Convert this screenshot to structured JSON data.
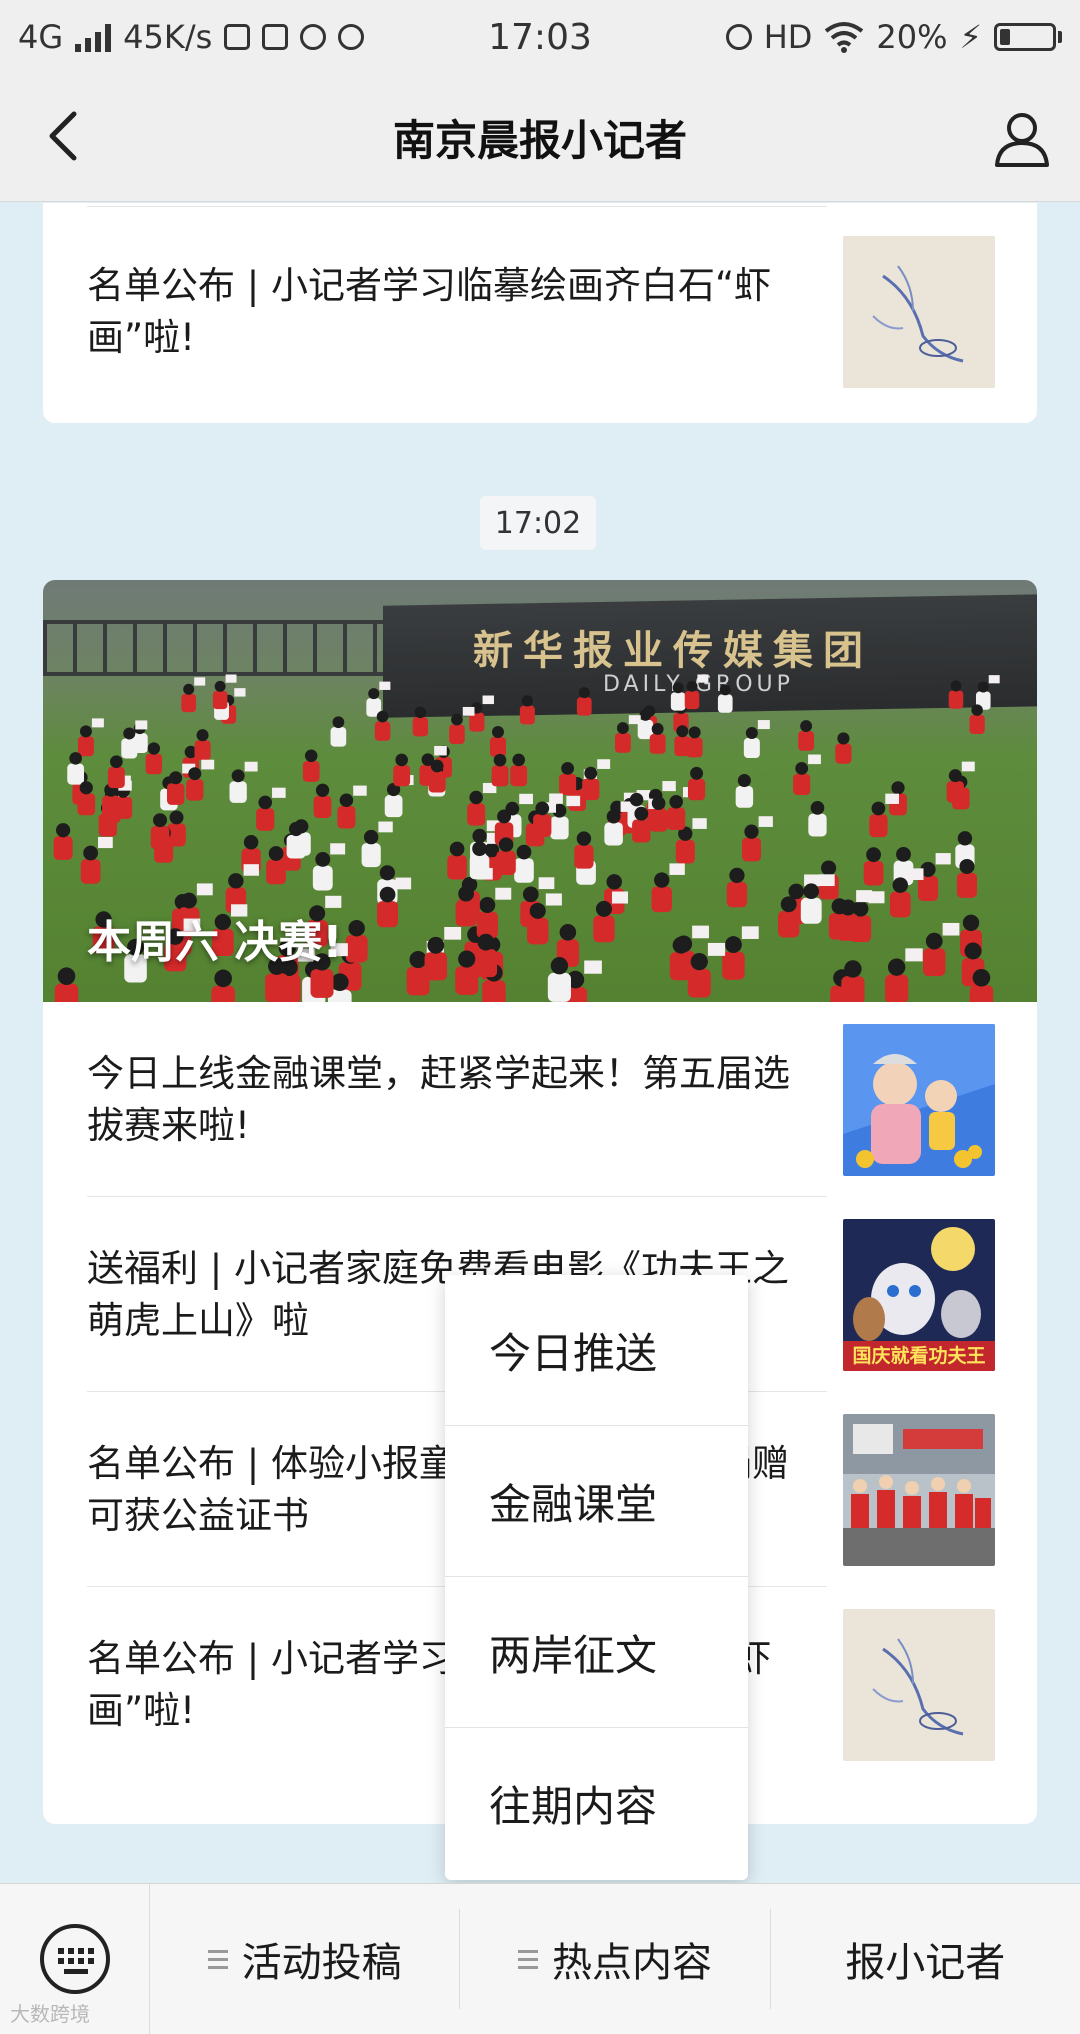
{
  "status_bar": {
    "network": "4G",
    "speed": "45K/s",
    "time": "17:03",
    "hd": "HD",
    "battery": "20%",
    "battery_level": 0.2
  },
  "nav": {
    "title": "南京晨报小记者",
    "back_icon": "chevron-left-icon",
    "profile_icon": "person-icon"
  },
  "messages": {
    "top_item": {
      "title": "名单公布 | 小记者学习临摹绘画齐白石“虾画”啦!"
    },
    "timestamp": "17:02",
    "hero": {
      "title": "本周六 决赛!",
      "wall_text": "新华报业传媒集团",
      "wall_text_en": "DAILY GROUP"
    },
    "items": [
      {
        "title": "今日上线金融课堂，赶紧学起来！第五届选拔赛来啦!"
      },
      {
        "title": "送福利 | 小记者家庭免费看电影《功夫王之萌虎上山》啦"
      },
      {
        "title": "名单公布 | 体验小报童，卖报义卖所得捐赠可获公益证书"
      },
      {
        "title": "名单公布 | 小记者学习临摹绘画齐白石“虾画”啦!"
      }
    ],
    "thumb_caption_2": "国庆就看功夫王"
  },
  "popup_menu": {
    "items": [
      "今日推送",
      "金融课堂",
      "两岸征文",
      "往期内容"
    ]
  },
  "bottom_bar": {
    "keyboard_icon": "keyboard-icon",
    "menus": [
      "活动投稿",
      "热点内容",
      "报小记者"
    ]
  },
  "watermark": "大数跨境"
}
